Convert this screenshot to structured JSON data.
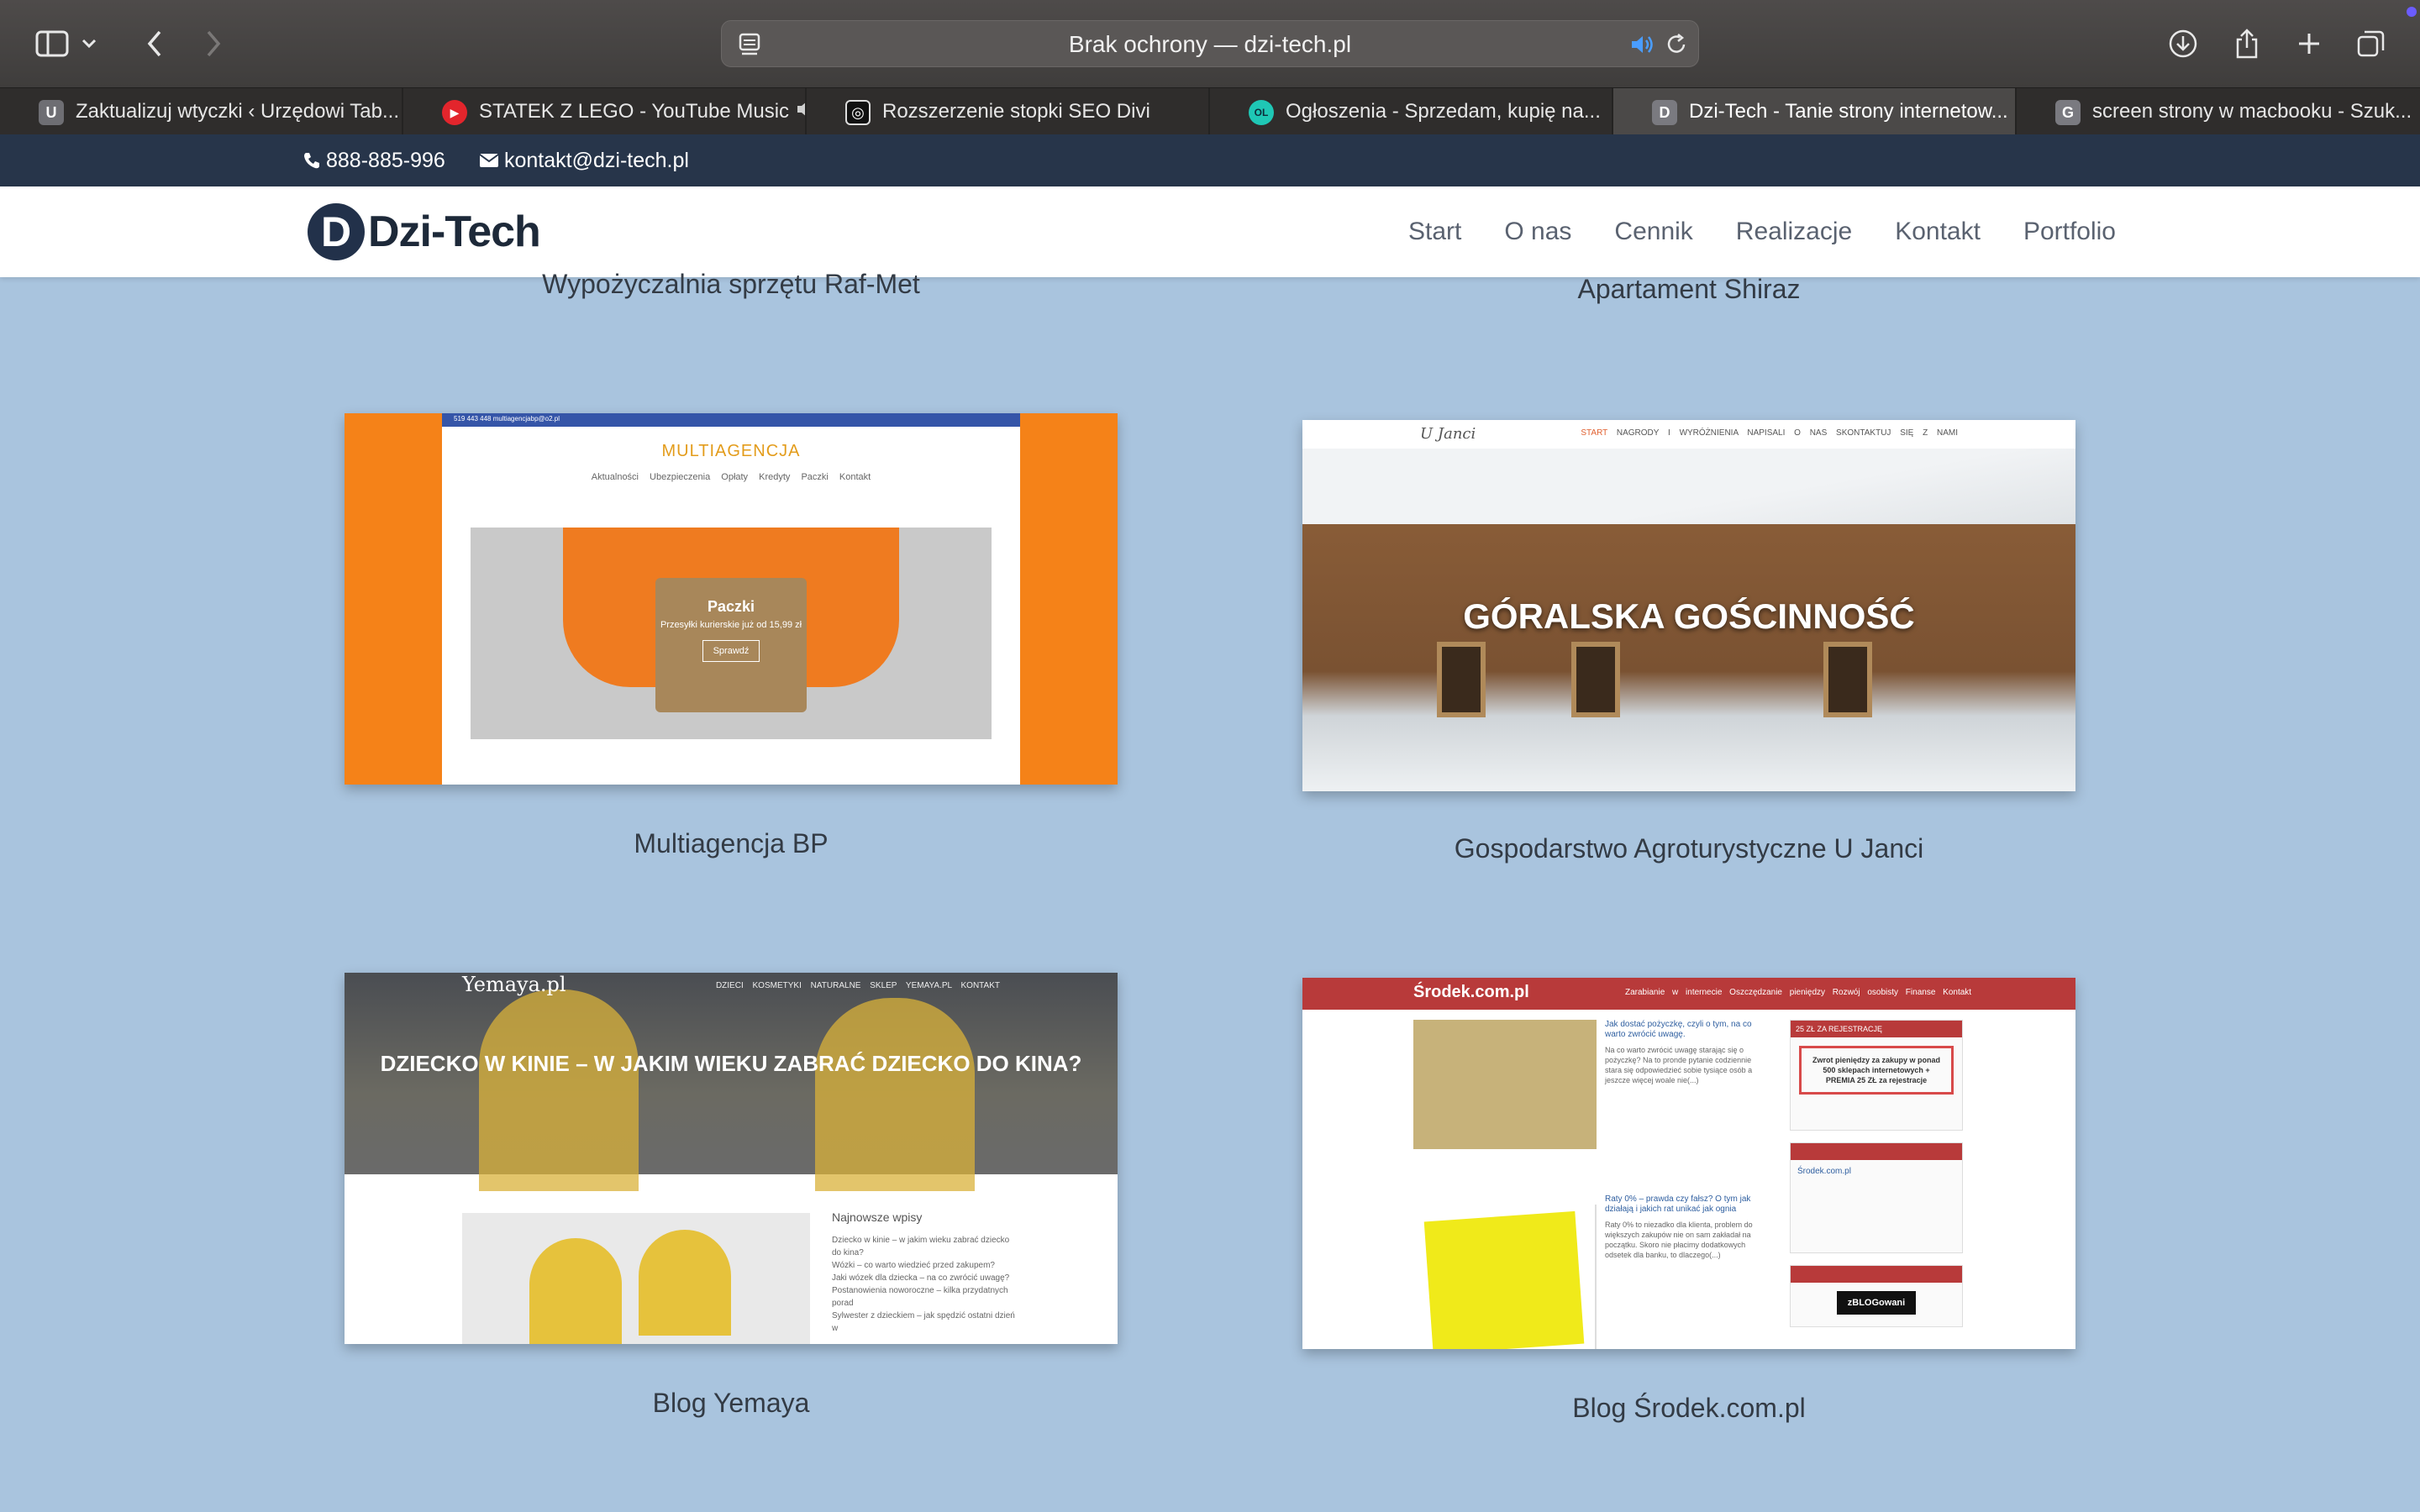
{
  "browser": {
    "address_text": "Brak ochrony — dzi-tech.pl",
    "tabs": [
      {
        "favicon": "U",
        "label": "Zaktualizuj wtyczki ‹ Urzędowi Tab...",
        "color": "#6e6e73",
        "active": false
      },
      {
        "favicon": "▶",
        "label": "STATEK Z LEGO - YouTube Music",
        "color": "#e3252c",
        "active": false
      },
      {
        "favicon": "◎",
        "label": "Rozszerzenie stopki SEO Divi",
        "color": "#111111",
        "active": false
      },
      {
        "favicon": "OL",
        "label": "Ogłoszenia - Sprzedam, kupię na...",
        "color": "#1fc7b5",
        "active": false
      },
      {
        "favicon": "D",
        "label": "Dzi-Tech - Tanie strony internetow...",
        "color": "#7a7a80",
        "active": true
      },
      {
        "favicon": "G",
        "label": "screen strony w macbooku - Szuk...",
        "color": "#7a7a80",
        "active": false
      }
    ]
  },
  "site": {
    "topbar": {
      "phone": "888-885-996",
      "email": "kontakt@dzi-tech.pl"
    },
    "logo": {
      "mark": "D",
      "name": "Dzi-Tech"
    },
    "nav": [
      "Start",
      "O nas",
      "Cennik",
      "Realizacje",
      "Kontakt",
      "Portfolio"
    ]
  },
  "portfolio": {
    "prev_captions": [
      "Wypożyczalnia sprzętu Raf-Met",
      "Apartament Shiraz"
    ],
    "items": [
      {
        "caption": "Multiagencja BP",
        "thumb": {
          "brand": "MULTIAGENCJA",
          "topbar": "519 443 448   multiagencjabp@o2.pl",
          "menu": "Aktualności Ubezpieczenia Opłaty Kredyty Paczki Kontakt",
          "hero_title": "Paczki",
          "hero_sub": "Przesyłki kurierskie już od 15,99 zł",
          "hero_button": "Sprawdź"
        }
      },
      {
        "caption": "Gospodarstwo Agroturystyczne U Janci",
        "thumb": {
          "logo": "U Janci",
          "nav_start": "START",
          "nav": "NAGRODY I WYRÓŻNIENIA   NAPISALI O NAS   SKONTAKTUJ SIĘ Z NAMI",
          "title": "GÓRALSKA GOŚCINNOŚĆ"
        }
      },
      {
        "caption": "Blog Yemaya",
        "thumb": {
          "logo": "Yemaya.pl",
          "menu": "DZIECI   KOSMETYKI NATURALNE   SKLEP YEMAYA.PL   KONTAKT",
          "title": "DZIECKO W KINIE – W JAKIM WIEKU ZABRAĆ DZIECKO DO KINA?",
          "sidebar_heading": "Najnowsze wpisy",
          "sidebar_items": [
            "Dziecko w kinie – w jakim wieku zabrać dziecko do kina?",
            "Wózki – co warto wiedzieć przed zakupem?",
            "Jaki wózek dla dziecka – na co zwrócić uwagę?",
            "Postanowienia noworoczne – kilka przydatnych porad",
            "Sylwester z dzieckiem – jak spędzić ostatni dzień w"
          ]
        }
      },
      {
        "caption": "Blog Środek.com.pl",
        "thumb": {
          "brand": "Środek.com.pl",
          "menu": "Zarabianie w internecie   Oszczędzanie pieniędzy   Rozwój osobisty   Finanse   Kontakt",
          "post1_title": "Jak dostać pożyczkę, czyli o tym, na co warto zwrócić uwagę.",
          "post1_text": "Na co warto zwrócić uwagę starając się o pożyczkę? Na to pronde pytanie codziennie stara się odpowiedzieć sobie tysiące osób a jeszcze więcej woale nie(...)",
          "post2_title": "Raty 0% – prawda czy fałsz? O tym jak działają i jakich rat unikać jak ognia",
          "post2_text": "Raty 0% to niezadko dla klienta, problem do większych zakupów nie on sam zakładał na początku. Skoro nie płacimy dodatkowych odsetek dla banku, to dlaczego(...)",
          "side1_heading": "25 ZŁ ZA REJESTRACJĘ",
          "side1_text": "Zwrot pieniędzy za zakupy w ponad 500 sklepach internetowych + PREMIA 25 ZŁ za rejestracje",
          "side2_name": "Środek.com.pl",
          "side3_badge": "zBLOGowani"
        }
      }
    ]
  }
}
